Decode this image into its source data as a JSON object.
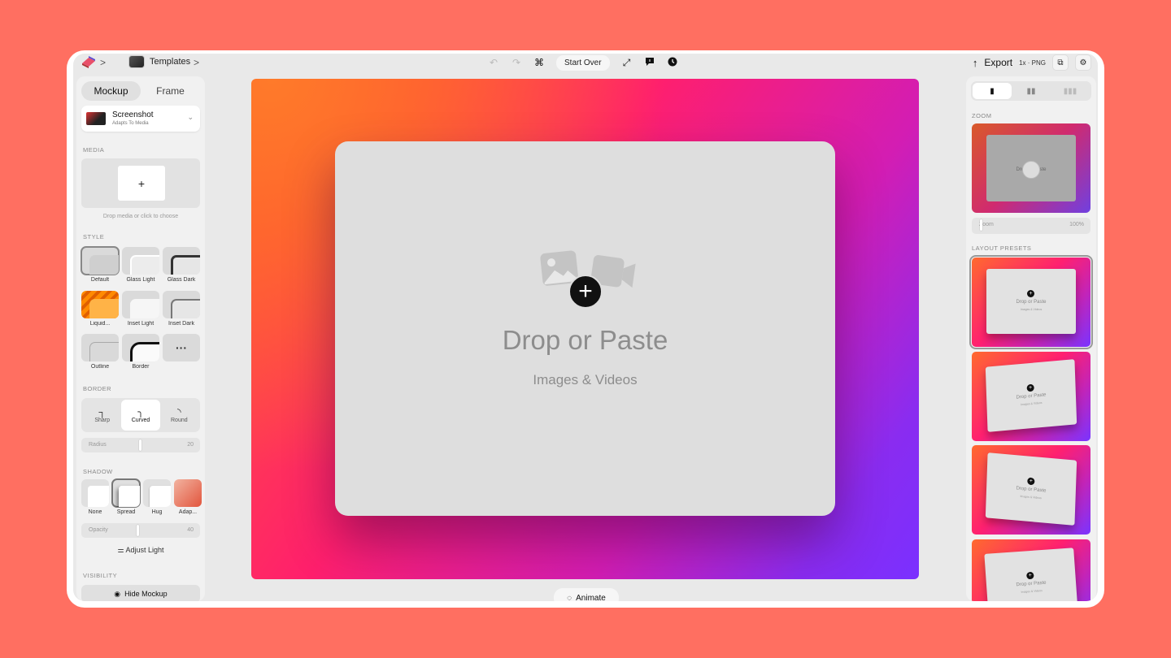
{
  "topbar": {
    "breadcrumb_sep": ">",
    "templates_label": "Templates",
    "templates_chevron": ">",
    "start_over": "Start Over",
    "export_label": "Export",
    "export_meta": "1x · PNG",
    "icons": [
      "undo-icon",
      "redo-icon",
      "command-icon",
      "expand-icon",
      "comment-icon",
      "history-icon"
    ]
  },
  "left": {
    "tabs": [
      {
        "label": "Mockup"
      },
      {
        "label": "Frame"
      }
    ],
    "media_select": {
      "title": "Screenshot",
      "subtitle": "Adapts To Media"
    },
    "media_label": "MEDIA",
    "drop_plus": "+",
    "drop_hint": "Drop media or click to choose",
    "style_label": "STYLE",
    "styles": [
      "Default",
      "Glass Light",
      "Glass Dark",
      "Liquid...",
      "Inset Light",
      "Inset Dark",
      "Outline",
      "Border"
    ],
    "more_glyph": "···",
    "border_label": "BORDER",
    "border_options": [
      "Sharp",
      "Curved",
      "Round"
    ],
    "radius": {
      "label": "Radius",
      "value": "20"
    },
    "shadow_label": "SHADOW",
    "shadows": [
      "None",
      "Spread",
      "Hug",
      "Adap..."
    ],
    "opacity": {
      "label": "Opacity",
      "value": "40"
    },
    "adjust_light": "Adjust Light",
    "visibility_label": "VISIBILITY",
    "hide_mockup": "Hide Mockup"
  },
  "canvas": {
    "plus": "+",
    "title": "Drop or Paste",
    "subtitle": "Images & Videos",
    "animate": "Animate"
  },
  "right": {
    "zoom_label": "ZOOM",
    "zoom_preview_text": "Drop or Paste",
    "zoom_slider": {
      "label": "Zoom",
      "value": "100%"
    },
    "presets_label": "LAYOUT PRESETS",
    "preset_title": "Drop or Paste",
    "preset_sub": "Images & Videos"
  },
  "colors": {
    "background": "#ff6f61",
    "canvas_start": "#ff5c33",
    "canvas_mid": "#ff1f6d",
    "canvas_end": "#7a30ff"
  }
}
